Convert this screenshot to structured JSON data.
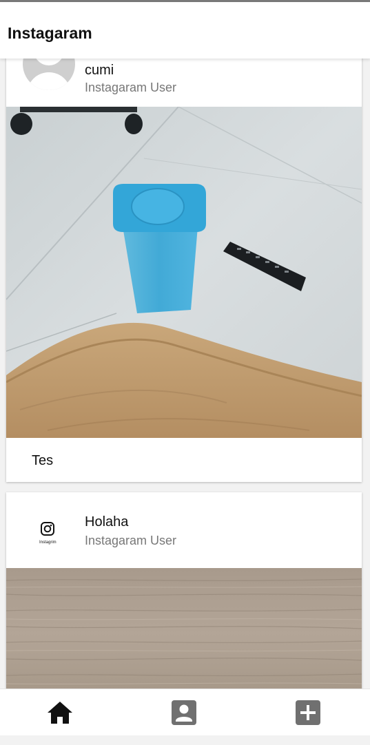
{
  "app": {
    "title": "Instagaram"
  },
  "posts": [
    {
      "username": "cumi",
      "user_type": "Instagaram User",
      "caption": "Tes"
    },
    {
      "username": "Holaha",
      "user_type": "Instagaram User",
      "avatar_text": "Instagrim"
    }
  ],
  "nav": {
    "items": [
      {
        "icon": "home-icon",
        "active": true
      },
      {
        "icon": "profile-icon",
        "active": false
      },
      {
        "icon": "add-box-icon",
        "active": false
      }
    ]
  },
  "colors": {
    "accent": "#111111",
    "muted": "#777777",
    "nav_inactive": "#707070"
  }
}
